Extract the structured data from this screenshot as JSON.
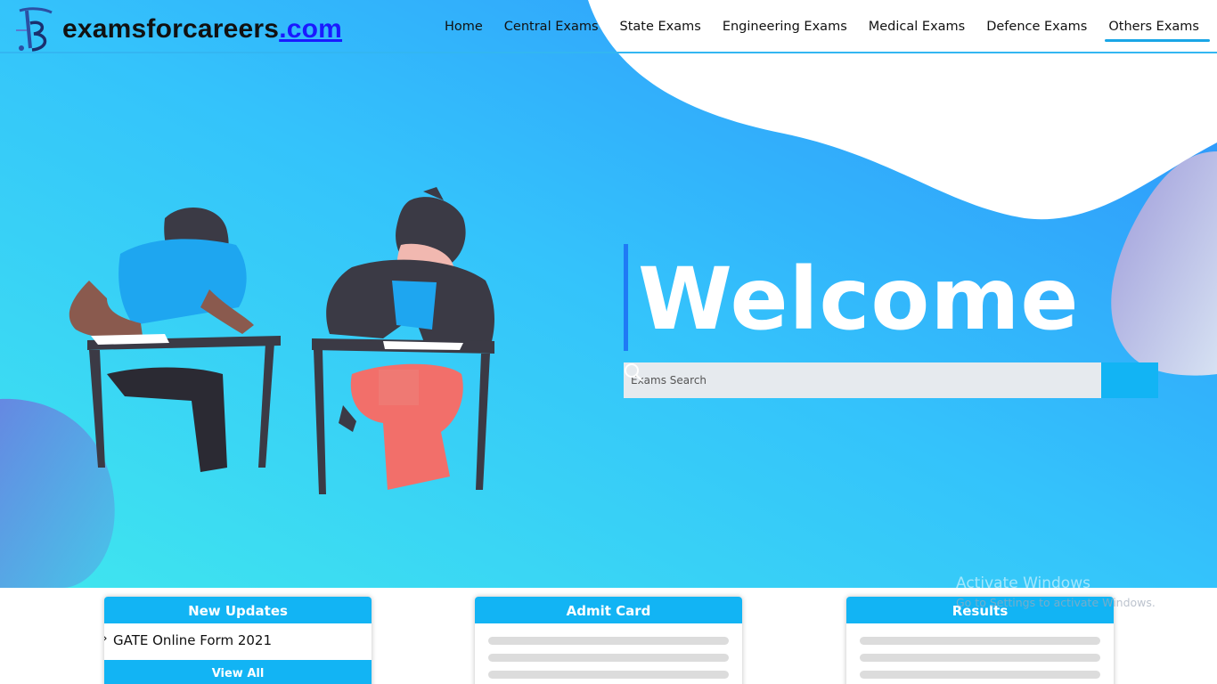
{
  "site": {
    "logo_name": "examsforcareers",
    "logo_tld": ".com"
  },
  "nav": {
    "items": [
      "Home",
      "Central Exams",
      "State Exams",
      "Engineering Exams",
      "Medical Exams",
      "Defence Exams",
      "Others Exams"
    ],
    "active": "Others Exams"
  },
  "hero": {
    "welcome": "Welcome",
    "search_placeholder": "Exams Search"
  },
  "cards": {
    "updates": {
      "title": "New Updates",
      "items": [
        "GATE Online Form 2021"
      ],
      "view_all": "View All"
    },
    "admit": {
      "title": "Admit Card"
    },
    "results": {
      "title": "Results"
    }
  },
  "watermark": {
    "title": "Activate Windows",
    "sub": "Go to Settings to activate Windows."
  },
  "colors": {
    "accent": "#12b4f4",
    "hero_start": "#3de3ef",
    "hero_end": "#2f9bff",
    "nav_underline": "#1aa6e6"
  },
  "icons": [
    "logo-icon",
    "search-icon"
  ]
}
